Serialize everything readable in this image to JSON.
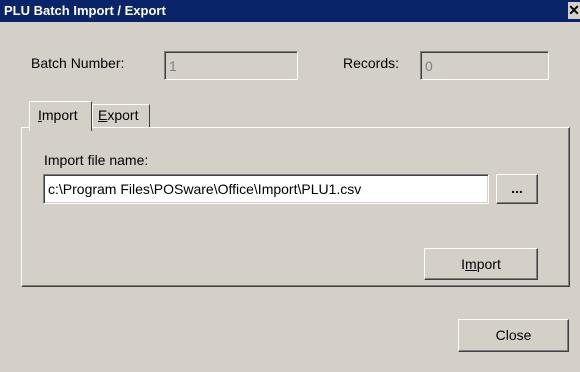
{
  "window": {
    "title": "PLU Batch Import / Export",
    "close_glyph": "✕"
  },
  "batch_number": {
    "label": "Batch Number:",
    "value": "1"
  },
  "records": {
    "label": "Records:",
    "value": "0"
  },
  "tabs": [
    {
      "label": "Import",
      "accel": "I",
      "rest": "mport",
      "active": true
    },
    {
      "label": "Export",
      "accel": "E",
      "rest": "xport",
      "active": false
    }
  ],
  "import_panel": {
    "file_label": "Import file name:",
    "file_path": "c:\\Program Files\\POSware\\Office\\Import\\PLU1.csv",
    "browse_label": "...",
    "import_button": {
      "label": "Import",
      "pre": "I",
      "accel": "m",
      "post": "port"
    }
  },
  "close_button": {
    "label": "Close"
  }
}
